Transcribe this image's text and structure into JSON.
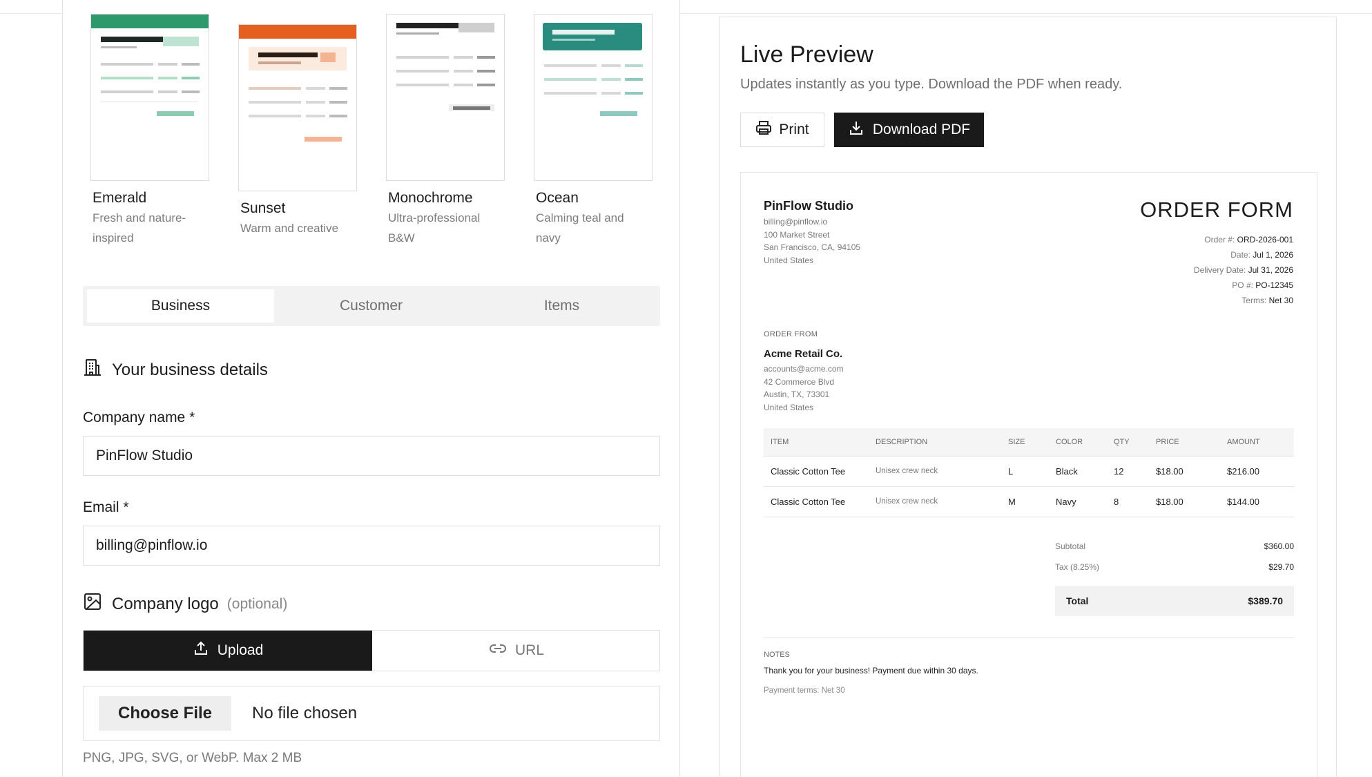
{
  "templates": [
    {
      "name": "Emerald",
      "desc": "Fresh and nature-inspired",
      "accent": "#2e9a6b"
    },
    {
      "name": "Sunset",
      "desc": "Warm and creative",
      "accent": "#e5601f"
    },
    {
      "name": "Monochrome",
      "desc": "Ultra-professional B&W",
      "accent": "#222222"
    },
    {
      "name": "Ocean",
      "desc": "Calming teal and navy",
      "accent": "#2a8c7e"
    }
  ],
  "tabs": [
    "Business",
    "Customer",
    "Items"
  ],
  "business_section": {
    "title": "Your business details"
  },
  "form": {
    "company_label": "Company name *",
    "company_value": "PinFlow Studio",
    "email_label": "Email *",
    "email_value": "billing@pinflow.io"
  },
  "logo_section": {
    "title": "Company logo",
    "optional": "(optional)",
    "upload_label": "Upload",
    "url_label": "URL",
    "choose_file": "Choose File",
    "no_file": "No file chosen",
    "hint": "PNG, JPG, SVG, or WebP. Max 2 MB"
  },
  "preview": {
    "title": "Live Preview",
    "subtitle": "Updates instantly as you type. Download the PDF when ready.",
    "print_label": "Print",
    "download_label": "Download PDF"
  },
  "document": {
    "business_name": "PinFlow Studio",
    "business_email": "billing@pinflow.io",
    "business_street": "100 Market Street",
    "business_city": "San Francisco, CA, 94105",
    "business_country": "United States",
    "title": "ORDER FORM",
    "meta": [
      {
        "label": "Order #:",
        "value": "ORD-2026-001"
      },
      {
        "label": "Date:",
        "value": "Jul 1, 2026"
      },
      {
        "label": "Delivery Date:",
        "value": "Jul 31, 2026"
      },
      {
        "label": "PO #:",
        "value": "PO-12345"
      },
      {
        "label": "Terms:",
        "value": "Net 30"
      }
    ],
    "order_from_label": "ORDER FROM",
    "customer_name": "Acme Retail Co.",
    "customer_email": "accounts@acme.com",
    "customer_street": "42 Commerce Blvd",
    "customer_city": "Austin, TX, 73301",
    "customer_country": "United States",
    "columns": [
      "ITEM",
      "DESCRIPTION",
      "SIZE",
      "COLOR",
      "QTY",
      "PRICE",
      "AMOUNT"
    ],
    "rows": [
      [
        "Classic Cotton Tee",
        "Unisex crew neck",
        "L",
        "Black",
        "12",
        "$18.00",
        "$216.00"
      ],
      [
        "Classic Cotton Tee",
        "Unisex crew neck",
        "M",
        "Navy",
        "8",
        "$18.00",
        "$144.00"
      ]
    ],
    "subtotal_label": "Subtotal",
    "subtotal_value": "$360.00",
    "tax_label": "Tax (8.25%)",
    "tax_value": "$29.70",
    "total_label": "Total",
    "total_value": "$389.70",
    "notes_label": "NOTES",
    "notes": "Thank you for your business! Payment due within 30 days.",
    "payment_terms": "Payment terms: Net 30"
  }
}
